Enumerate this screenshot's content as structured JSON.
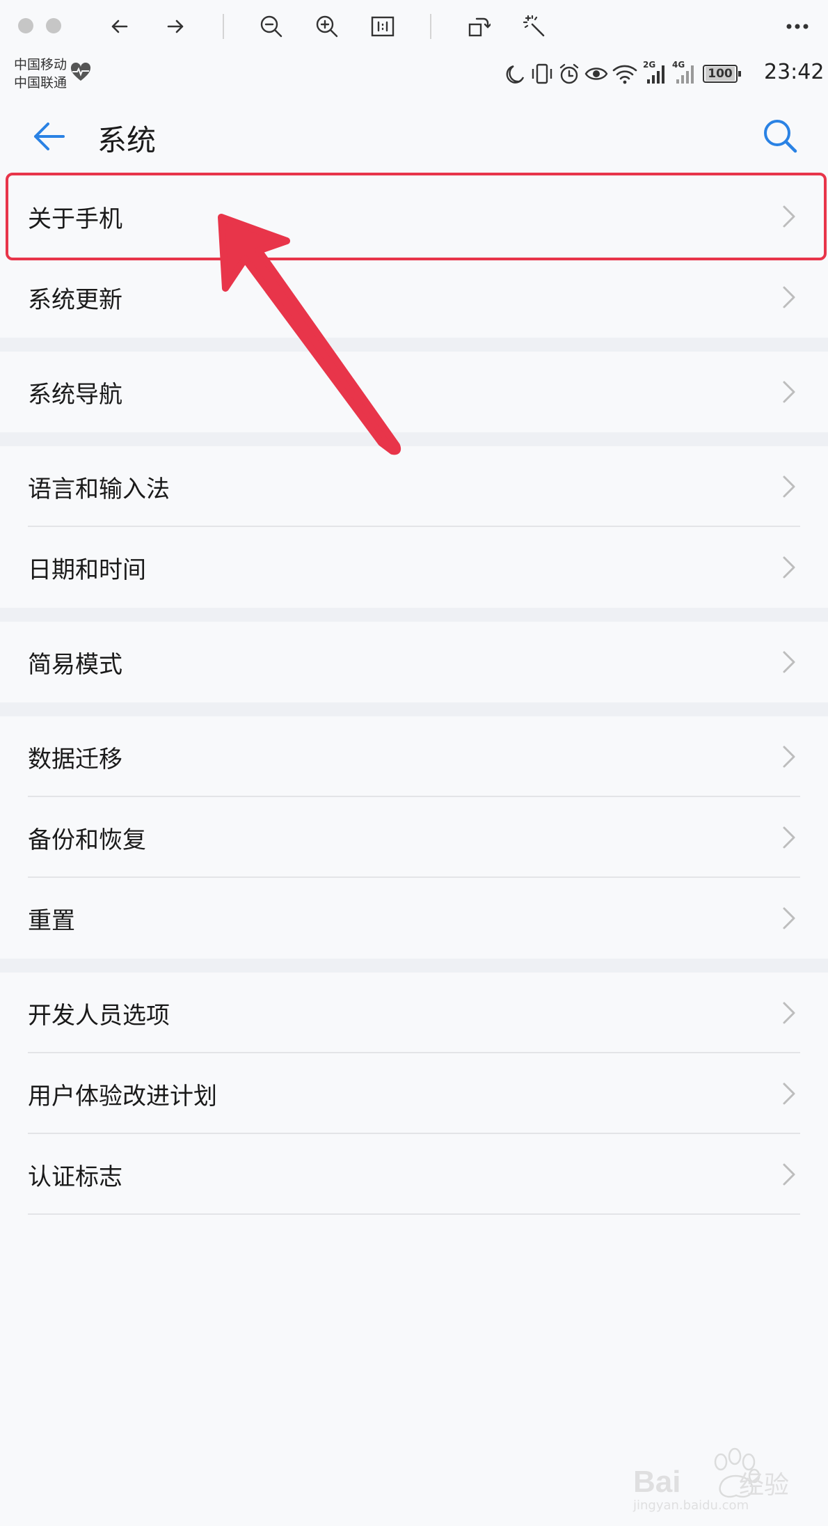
{
  "viewer": {
    "icons": [
      "close-icon",
      "minimize-icon",
      "arrow-left-icon",
      "arrow-right-icon",
      "zoom-out-icon",
      "zoom-in-icon",
      "actual-size-icon",
      "rotate-icon",
      "magic-wand-icon",
      "more-icon"
    ]
  },
  "status_bar": {
    "carrier_1": "中国移动",
    "carrier_2": "中国联通",
    "network_1": "2G",
    "network_2": "4G",
    "battery": "100",
    "time": "23:42"
  },
  "app_bar": {
    "title": "系统"
  },
  "groups": [
    {
      "items": [
        "关于手机",
        "系统更新"
      ]
    },
    {
      "items": [
        "系统导航"
      ]
    },
    {
      "items": [
        "语言和输入法",
        "日期和时间"
      ]
    },
    {
      "items": [
        "简易模式"
      ]
    },
    {
      "items": [
        "数据迁移",
        "备份和恢复",
        "重置"
      ]
    },
    {
      "items": [
        "开发人员选项",
        "用户体验改进计划",
        "认证标志"
      ]
    }
  ],
  "watermark": {
    "brand": "Bai",
    "brand_suffix": "经验",
    "url": "jingyan.baidu.com"
  },
  "colors": {
    "accent": "#2a82e4",
    "highlight": "#e8354a",
    "background": "#f8f9fb",
    "divider": "#e3e4e7"
  }
}
